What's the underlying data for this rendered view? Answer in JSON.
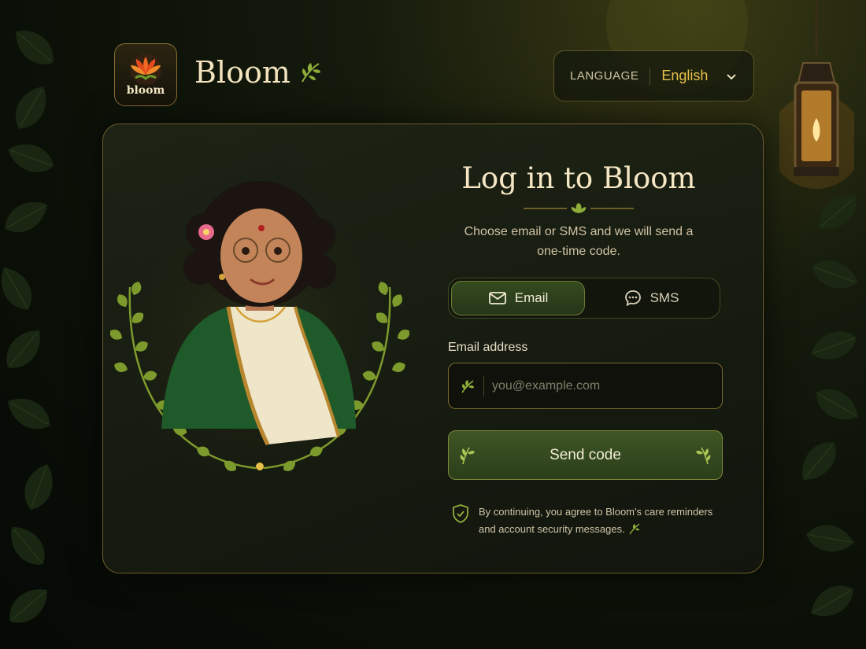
{
  "header": {
    "logo_text": "bloom",
    "brand": "Bloom",
    "language_label": "LANGUAGE",
    "language_value": "English"
  },
  "login": {
    "title": "Log in to Bloom",
    "subtitle": "Choose email or SMS and we will send a one-time code.",
    "tabs": [
      {
        "label": "Email",
        "icon": "envelope-icon",
        "active": true
      },
      {
        "label": "SMS",
        "icon": "chat-bubble-icon",
        "active": false
      }
    ],
    "email_label": "Email address",
    "email_placeholder": "you@example.com",
    "email_value": "",
    "send_label": "Send code",
    "consent": "By continuing, you agree to Bloom's care reminders and account security messages."
  },
  "colors": {
    "accent_gold": "#e8c04a",
    "leaf_green": "#8fae3a",
    "button_green": "#3e5624"
  }
}
